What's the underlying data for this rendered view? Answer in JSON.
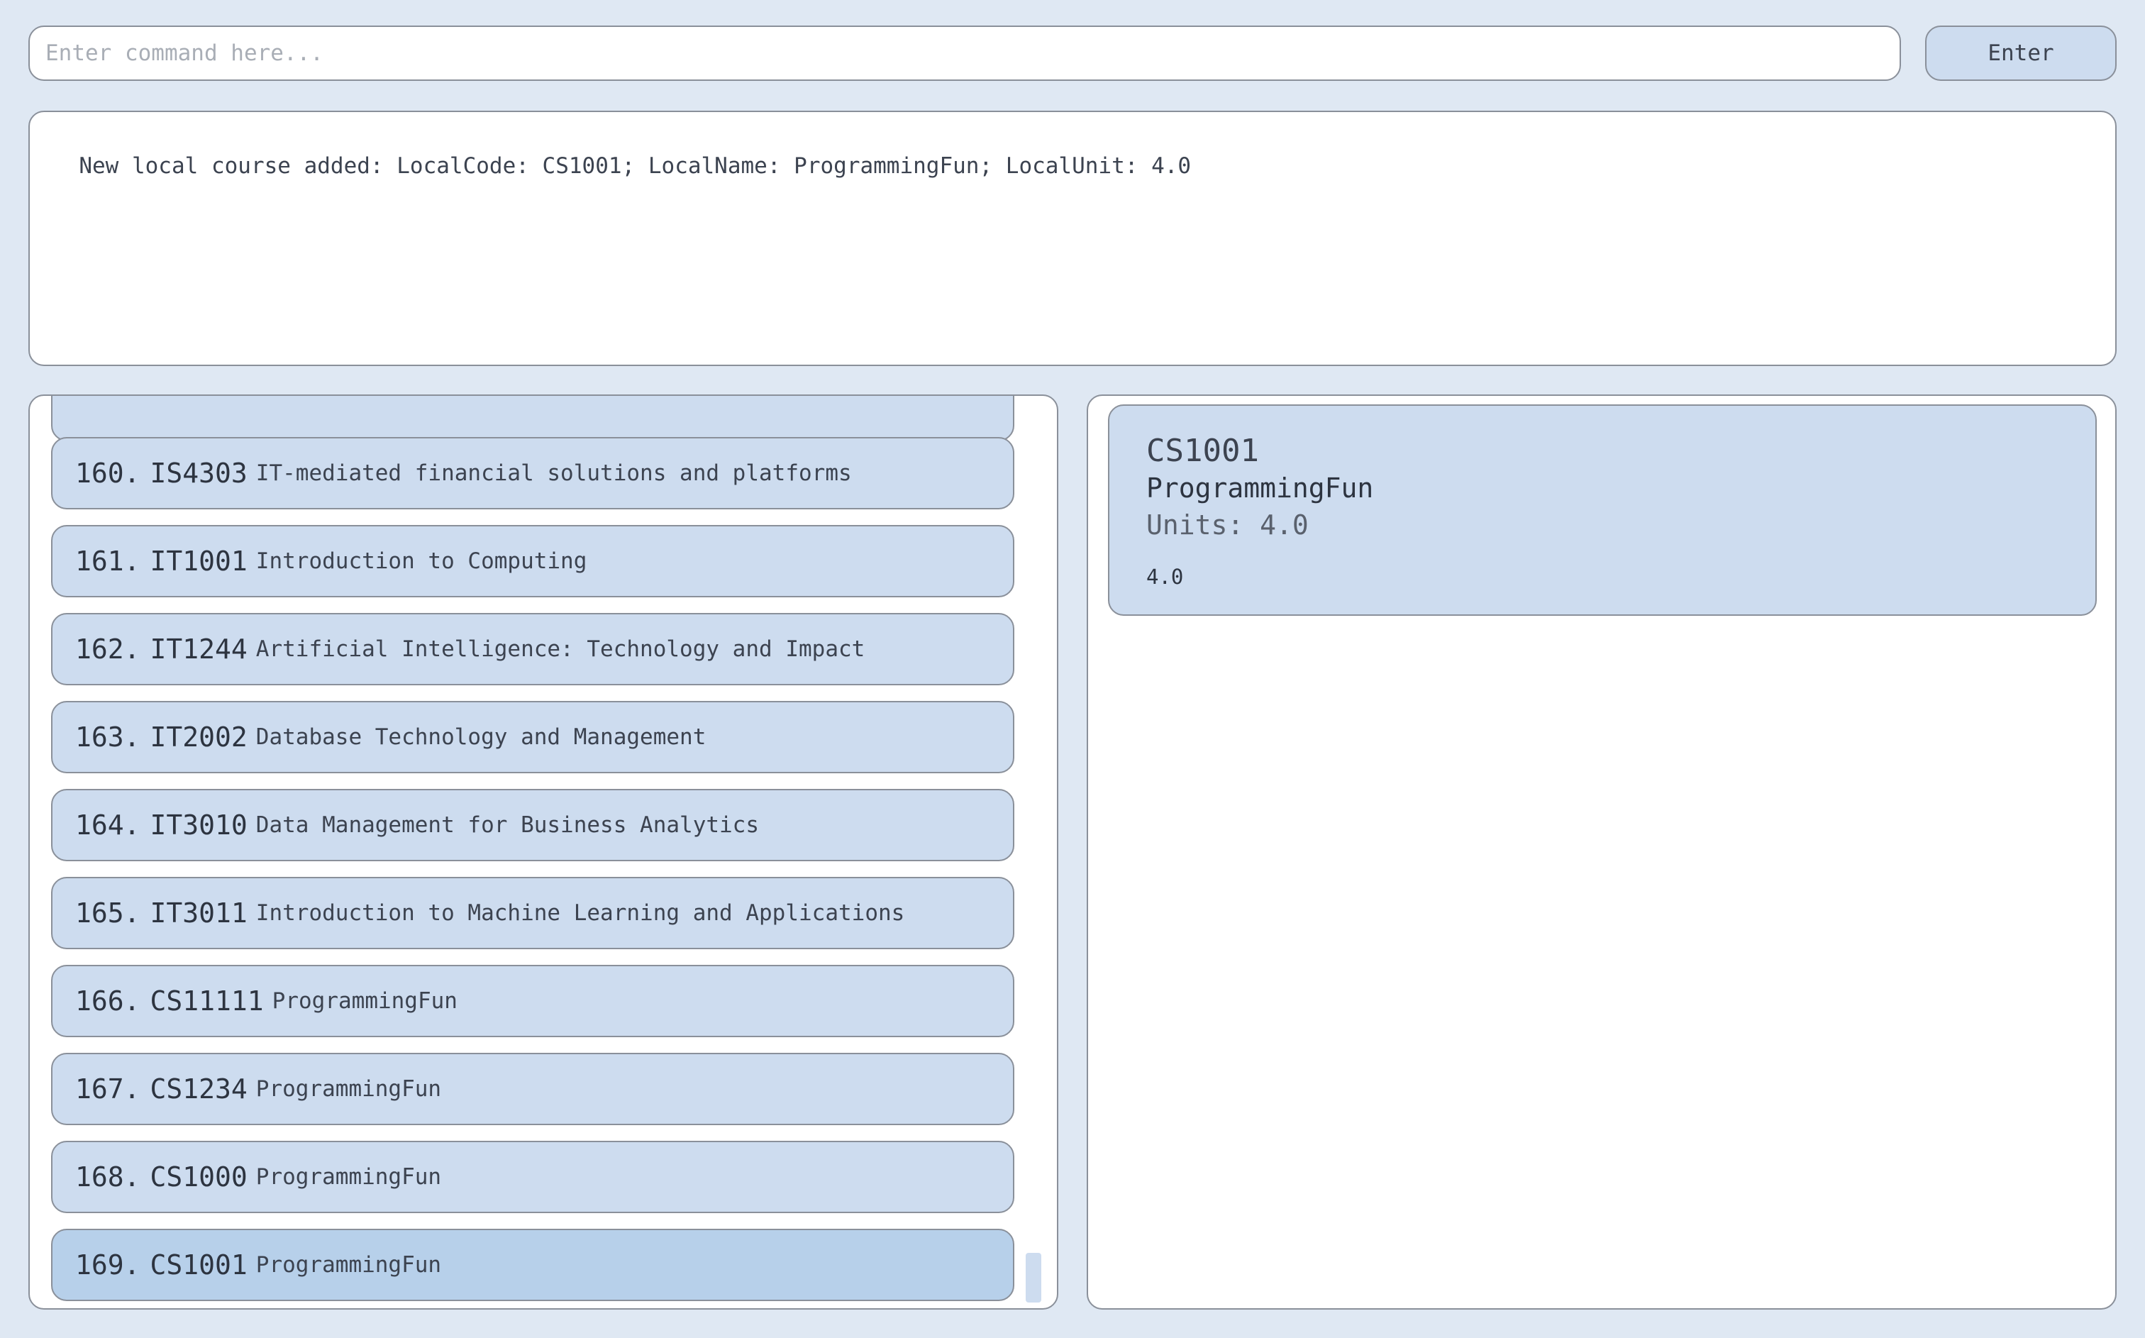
{
  "command": {
    "placeholder": "Enter command here...",
    "value": "",
    "button_label": "Enter"
  },
  "result": {
    "message": "New local course added: LocalCode: CS1001; LocalName: ProgrammingFun; LocalUnit: 4.0"
  },
  "course_list": {
    "items": [
      {
        "index": "",
        "code": "",
        "name": ""
      },
      {
        "index": "160.",
        "code": "IS4303",
        "name": "IT-mediated financial solutions and platforms"
      },
      {
        "index": "161.",
        "code": "IT1001",
        "name": "Introduction to Computing"
      },
      {
        "index": "162.",
        "code": "IT1244",
        "name": "Artificial Intelligence: Technology and Impact"
      },
      {
        "index": "163.",
        "code": "IT2002",
        "name": "Database Technology and Management"
      },
      {
        "index": "164.",
        "code": "IT3010",
        "name": "Data Management for Business Analytics"
      },
      {
        "index": "165.",
        "code": "IT3011",
        "name": "Introduction to Machine Learning and Applications"
      },
      {
        "index": "166.",
        "code": "CS11111",
        "name": "ProgrammingFun"
      },
      {
        "index": "167.",
        "code": "CS1234",
        "name": "ProgrammingFun"
      },
      {
        "index": "168.",
        "code": "CS1000",
        "name": "ProgrammingFun"
      },
      {
        "index": "169.",
        "code": "CS1001",
        "name": "ProgrammingFun"
      }
    ],
    "selected_index": "169."
  },
  "detail": {
    "code": "CS1001",
    "name": "ProgrammingFun",
    "units_label": "Units: 4.0",
    "unit_value": "4.0"
  }
}
